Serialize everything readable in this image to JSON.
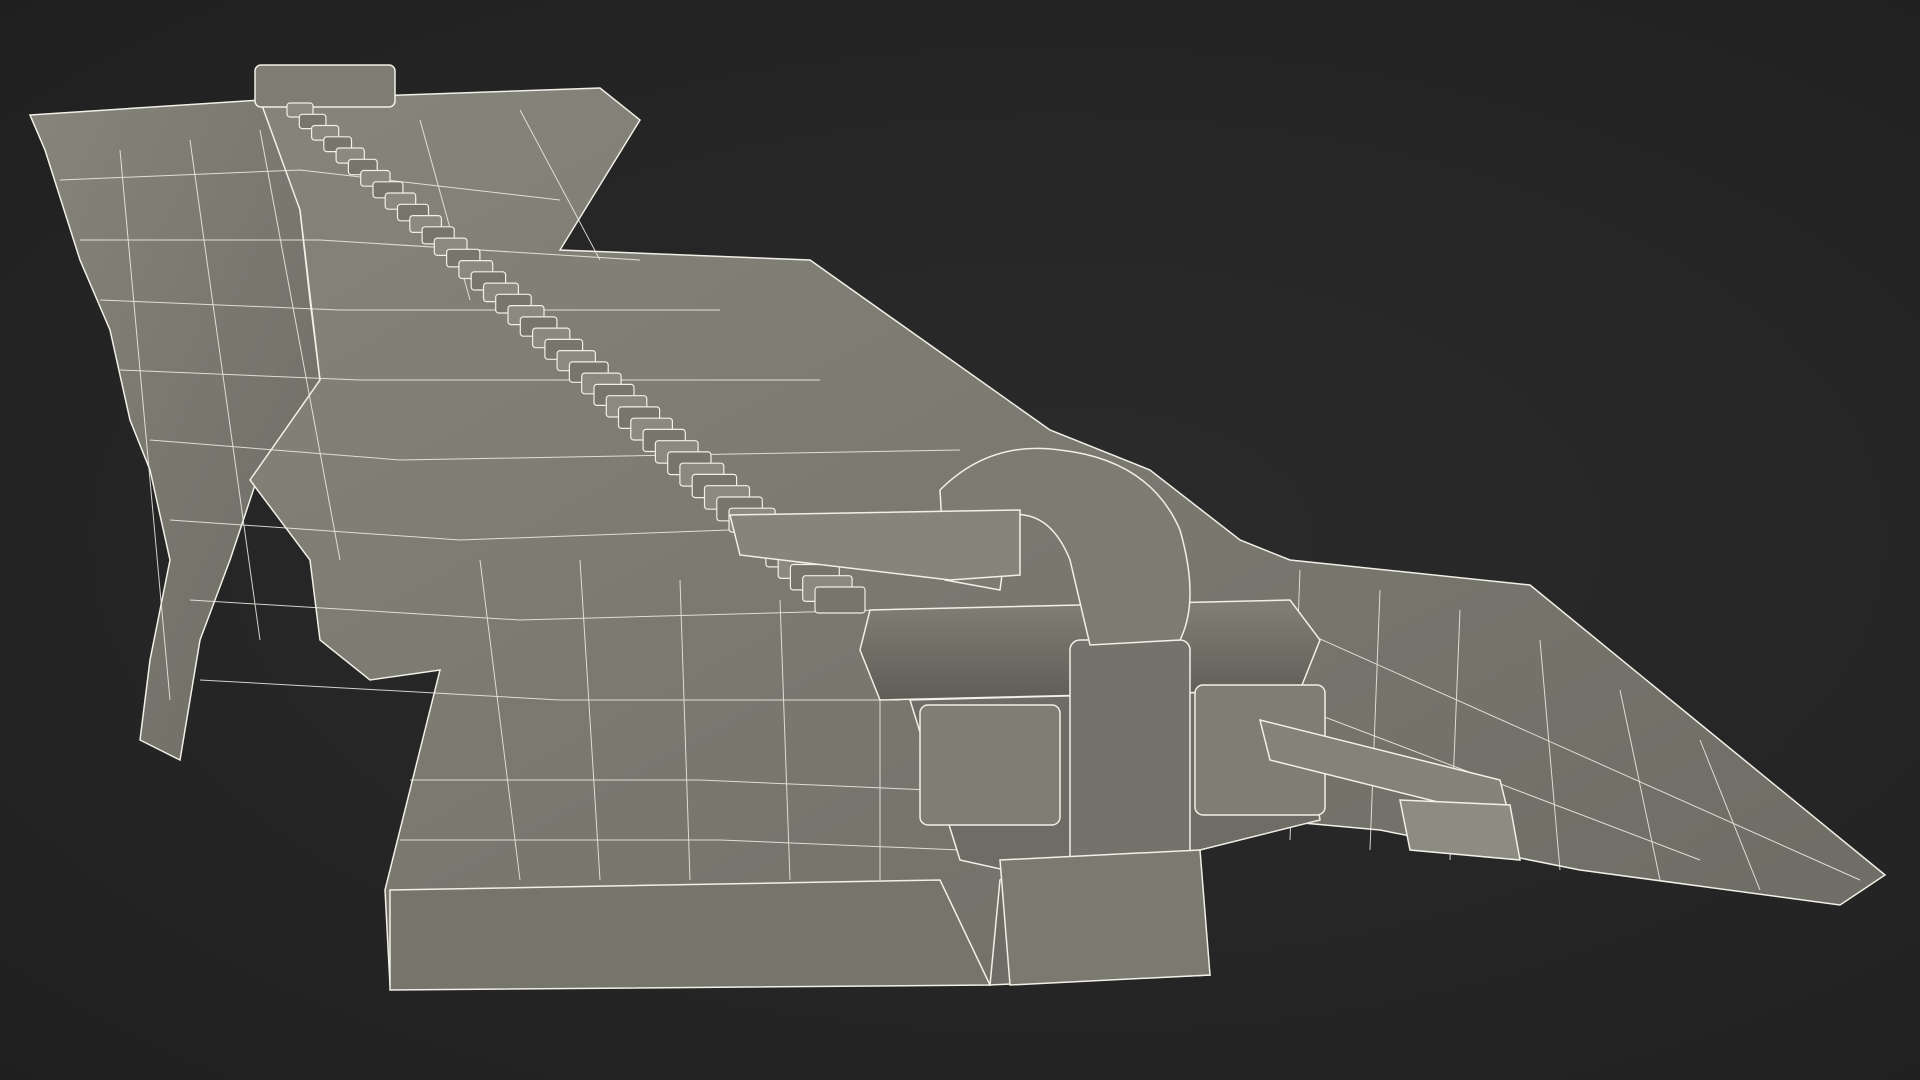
{
  "scene": {
    "background_color": "#262626",
    "model_fill_color": "#7a7a70",
    "model_dark_color": "#5f5f57",
    "model_light_color": "#8e8e84",
    "wire_color": "#f2f0e6",
    "subject": "zipper-wireframe-model"
  }
}
